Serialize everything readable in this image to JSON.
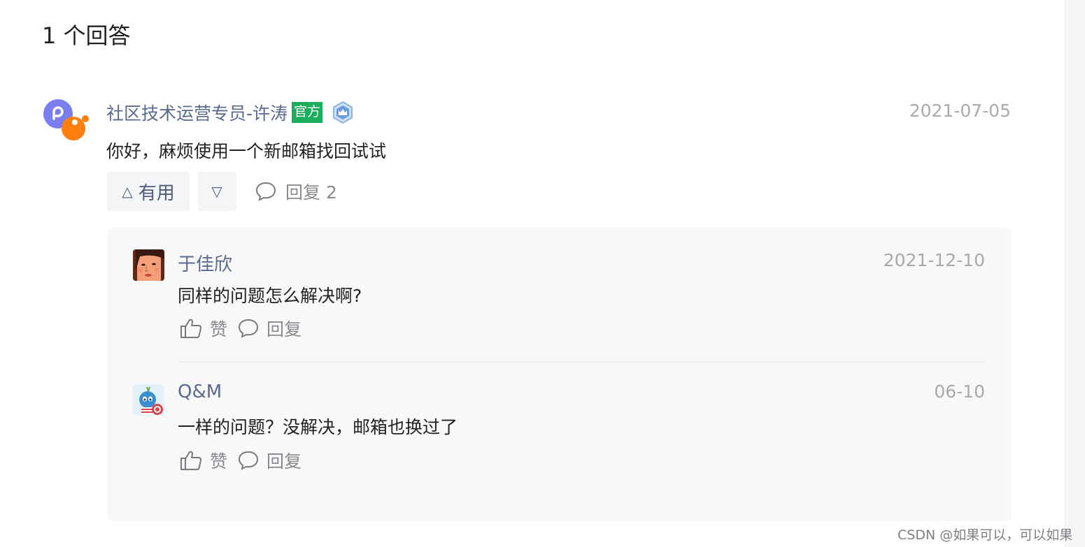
{
  "answer_count": "1 个回答",
  "answer": {
    "author": "社区技术运营专员-许涛",
    "official_tag": "官方",
    "badge_icon": "crown-badge-icon",
    "date": "2021-07-05",
    "text": "你好，麻烦使用一个新邮箱找回试试",
    "useful_label": "有用",
    "useful_icon": "triangle-up-icon",
    "down_icon": "triangle-down-icon",
    "reply_label": "回复 2"
  },
  "replies": [
    {
      "author": "于佳欣",
      "date": "2021-12-10",
      "text": "同样的问题怎么解决啊?",
      "like_label": "赞",
      "reply_label": "回复"
    },
    {
      "author": "Q&M",
      "date": "06-10",
      "text": "一样的问题？没解决，邮箱也换过了",
      "like_label": "赞",
      "reply_label": "回复"
    }
  ],
  "watermark": "CSDN @如果可以，可以如果",
  "colors": {
    "author_link": "#5a6a8e",
    "official_green": "#1aad5c",
    "muted": "#a8aab0",
    "reply_bg": "#f8f8f9"
  }
}
